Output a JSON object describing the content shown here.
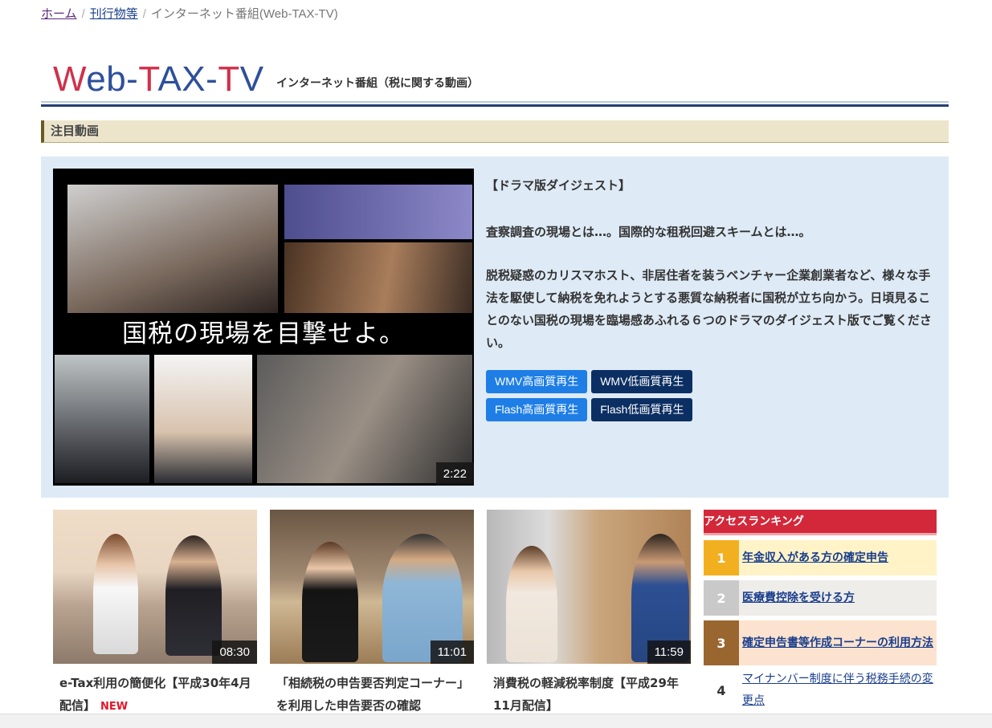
{
  "breadcrumb": {
    "home": "ホーム",
    "publications": "刊行物等",
    "current": "インターネット番組(Web-TAX-TV)",
    "sep": "/"
  },
  "brand": {
    "w": "W",
    "eb": "eb-",
    "t": "T",
    "ax": "AX-",
    "t2": "T",
    "v": "V",
    "subtitle": "インターネット番組（税に関する動画）"
  },
  "section_title": "注目動画",
  "featured": {
    "caption": "国税の現場を目撃せよ。",
    "duration": "2:22",
    "title": "【ドラマ版ダイジェスト】",
    "lead": "査察調査の現場とは…。国際的な租税回避スキームとは…。",
    "body": "脱税疑惑のカリスマホスト、非居住者を装うベンチャー企業創業者など、様々な手法を駆使して納税を免れようとする悪質な納税者に国税が立ち向かう。日頃見ることのない国税の現場を臨場感あふれる６つのドラマのダイジェスト版でご覧ください。",
    "buttons": {
      "wmv_high": "WMV高画質再生",
      "wmv_low": "WMV低画質再生",
      "flash_high": "Flash高画質再生",
      "flash_low": "Flash低画質再生"
    }
  },
  "cards": [
    {
      "duration": "08:30",
      "title": "e-Tax利用の簡便化【平成30年4月配信】",
      "badge": "NEW"
    },
    {
      "duration": "11:01",
      "title": "「相続税の申告要否判定コーナー」を利用した申告要否の確認"
    },
    {
      "duration": "11:59",
      "title": "消費税の軽減税率制度【平成29年11月配信】"
    }
  ],
  "ranking": {
    "title": "アクセスランキング",
    "items": [
      {
        "rank": "1",
        "label": "年金収入がある方の確定申告"
      },
      {
        "rank": "2",
        "label": "医療費控除を受ける方"
      },
      {
        "rank": "3",
        "label": "確定申告書等作成コーナーの利用方法"
      },
      {
        "rank": "4",
        "label": "マイナンバー制度に伴う税務手続の変更点"
      }
    ]
  },
  "colors": {
    "brand_red": "#d0304a",
    "brand_blue": "#2e4f9b",
    "ranking_red": "#d3283a",
    "button_light": "#1e7ee6",
    "button_dark": "#0c2f63",
    "featured_bg": "#deeaf6"
  }
}
